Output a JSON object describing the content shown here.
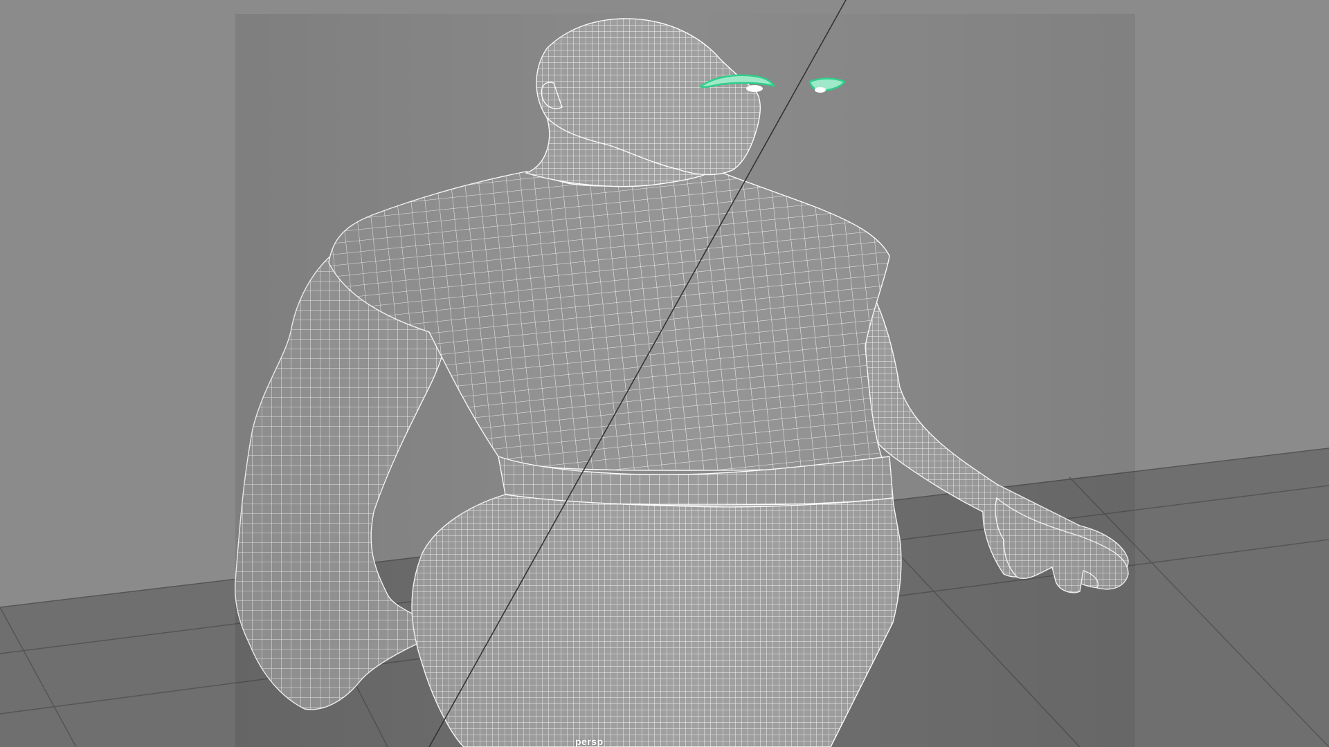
{
  "viewport": {
    "camera_name": "persp",
    "background_color": "#8b8b8b",
    "floor_color": "#6e6e6e",
    "grid_color": "#505050",
    "mesh_fill_color": "#9a9a9a",
    "wireframe_color": "#ffffff",
    "selection_color": "#3fd99a"
  }
}
